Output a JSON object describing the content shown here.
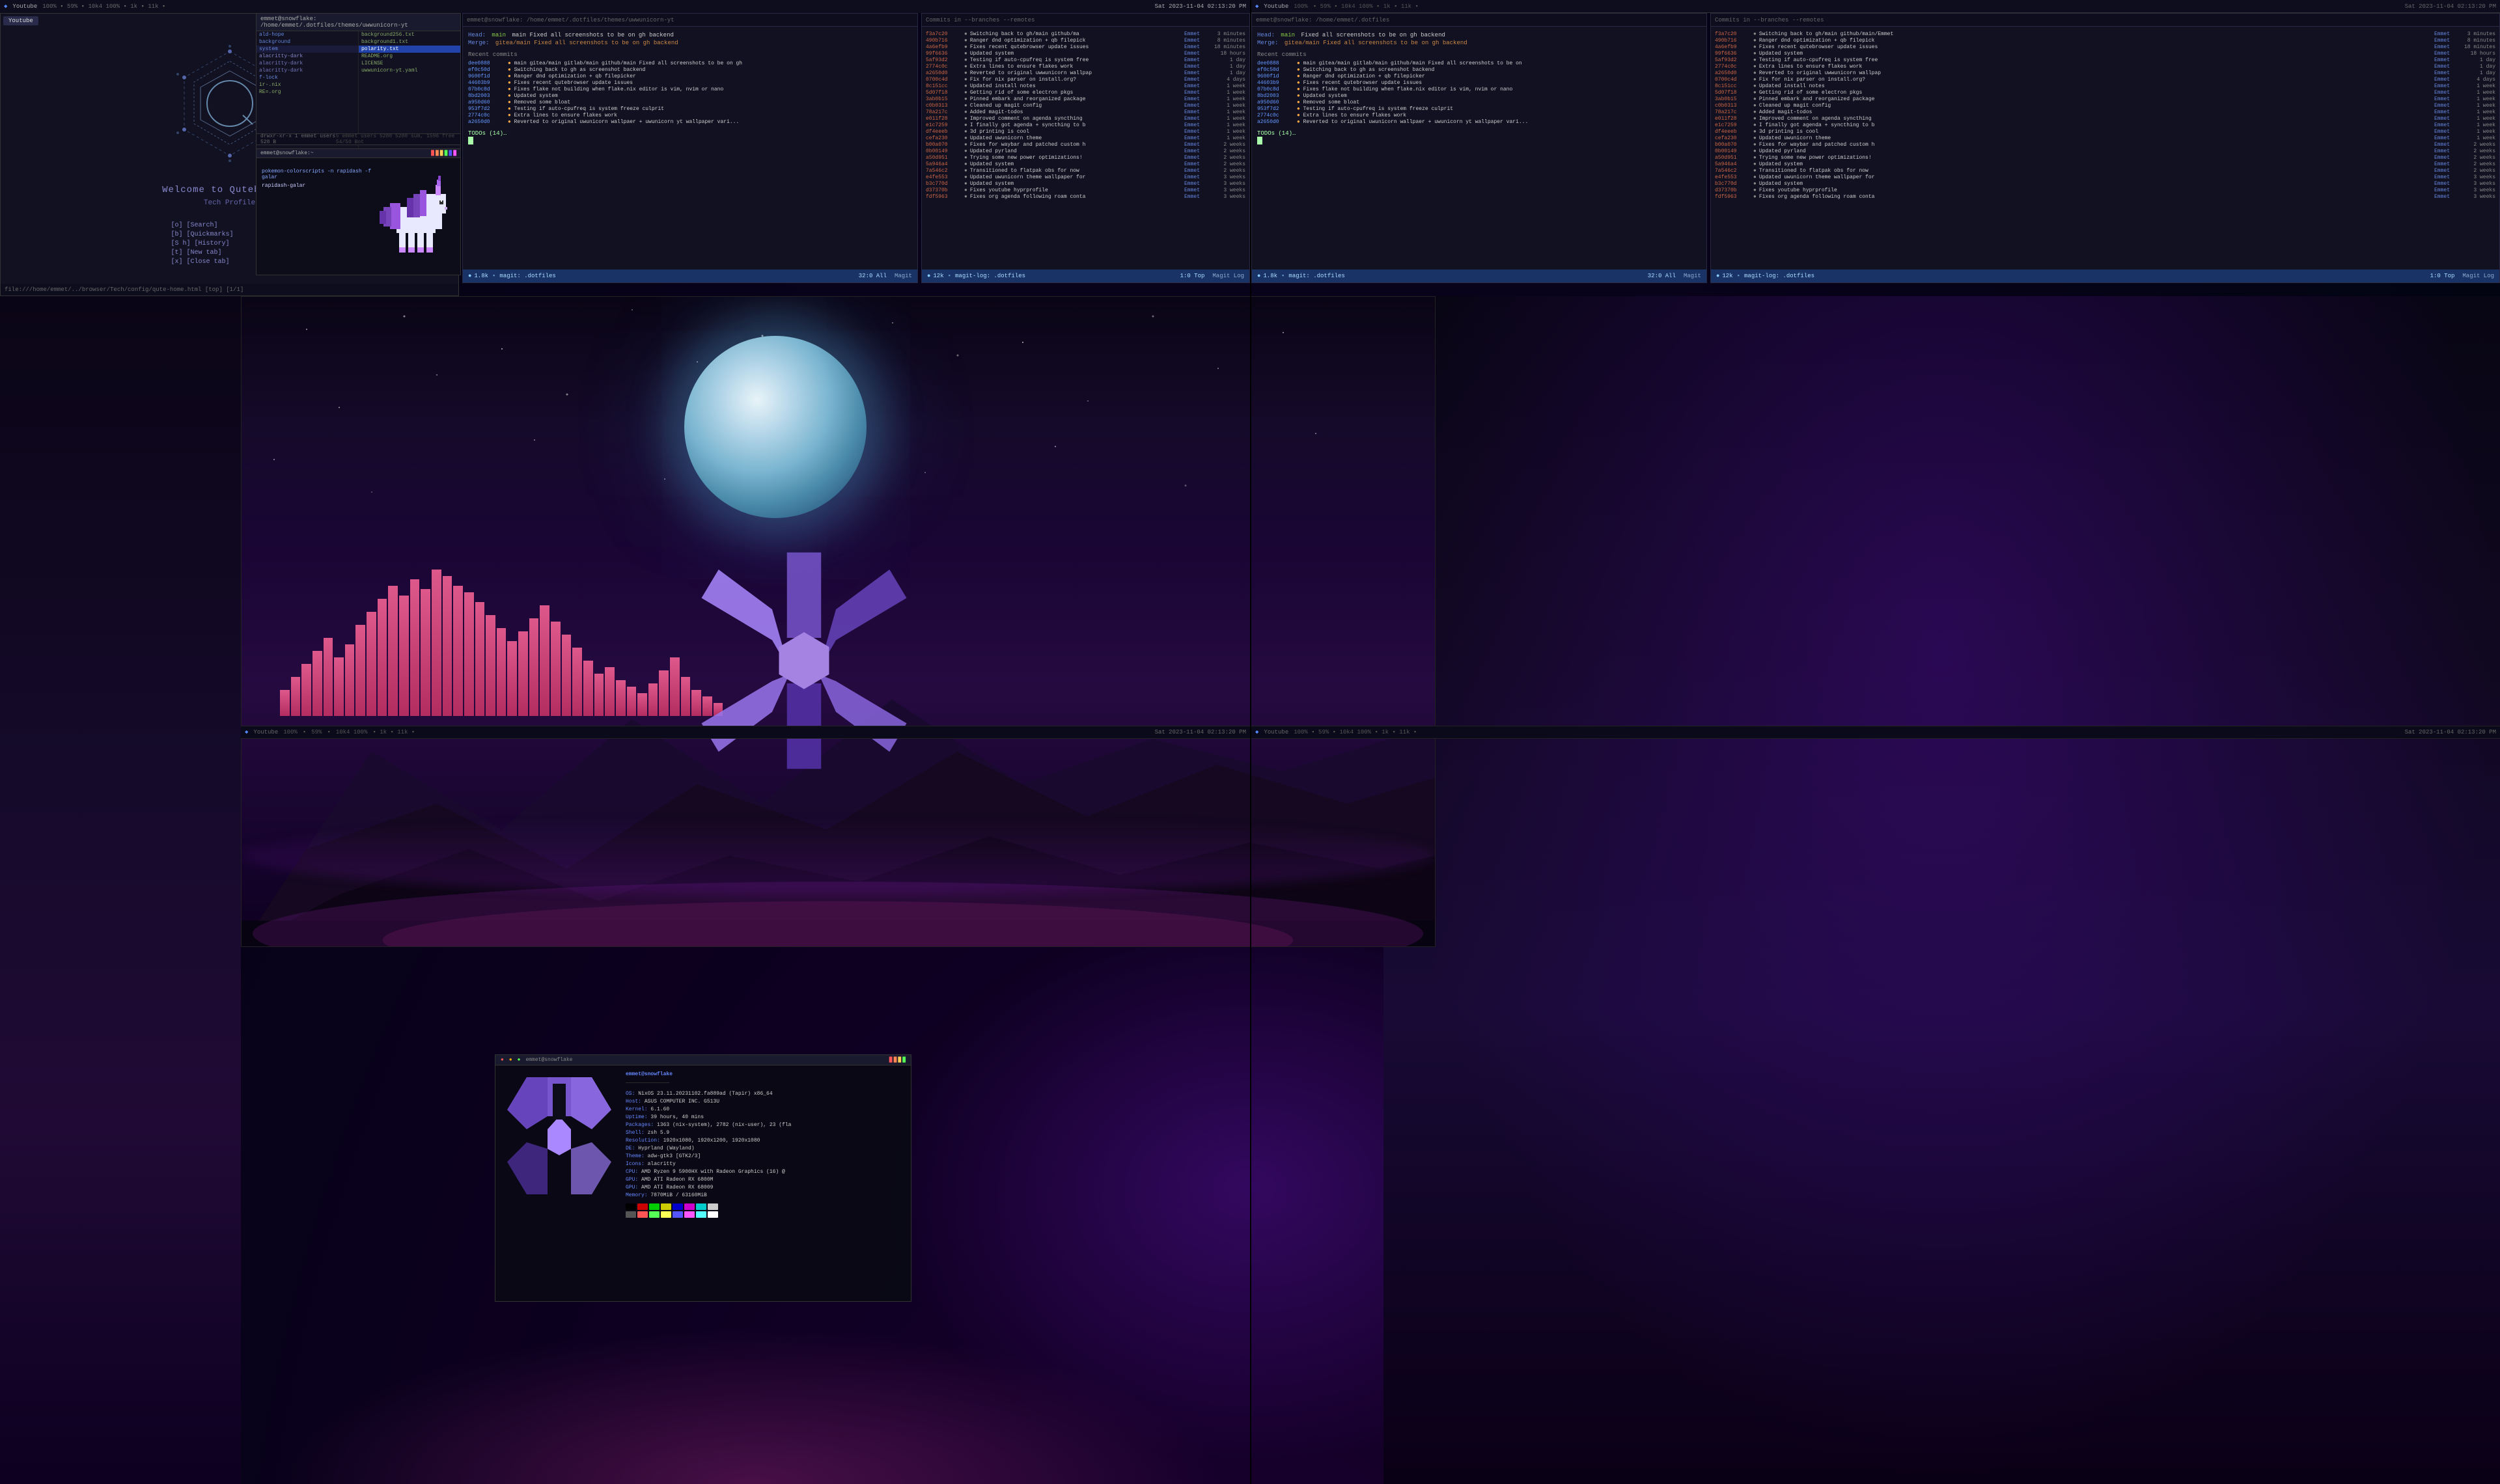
{
  "monitor1": {
    "left_panel": {
      "tab_label": "Youtube",
      "tab_state": "100%",
      "title": "Welcome to Qutebrowser",
      "subtitle": "Tech Profile",
      "menu": [
        "[o] [Search]",
        "[b] [Quickmarks]",
        "[S h] [History]",
        "[t] [New tab]",
        "[x] [Close tab]"
      ],
      "status": "file:///home/emmet/../browser/Tech/config/qute-home.html [top] [1/1]"
    },
    "file_panel": {
      "header": "emmet@snowflake: /home/emmet/.dotfiles/themes/uwwunicorn-yt",
      "col1_files": [
        {
          "name": "ald-hope",
          "type": "dir"
        },
        {
          "name": "background",
          "type": "dir"
        },
        {
          "name": "system",
          "type": "dir"
        },
        {
          "name": "alacritty-dark",
          "type": "dir"
        },
        {
          "name": "alacritty-dark",
          "type": "dir"
        },
        {
          "name": "alacritty-dark",
          "type": "dir"
        },
        {
          "name": "f-lock",
          "type": "dir"
        },
        {
          "name": "ir-.nix",
          "type": "txt"
        },
        {
          "name": "RE=.org",
          "type": "txt"
        }
      ],
      "col2_files": [
        {
          "name": "background256.txt",
          "type": "txt"
        },
        {
          "name": "background1.txt",
          "type": "txt"
        },
        {
          "name": "polarity.txt",
          "type": "txt",
          "selected": true
        },
        {
          "name": "README.org",
          "type": "txt"
        },
        {
          "name": "LICENSE",
          "type": "txt"
        },
        {
          "name": "uwwunicorn-yt.yaml",
          "type": "txt"
        }
      ]
    },
    "pokemon_panel": {
      "header": "emmet@snowflake:~",
      "command": "pokemon-colorscripts -n rapidash -f galar",
      "pokemon_name": "rapidash-galar"
    }
  },
  "git_panel": {
    "header": "emmet@snowflake: /home/emmet/.dotfiles/themes/uwwunicorn-yt",
    "merge_head": "main Fixed all screenshots to be on gh backend",
    "merge_val": "gitea/main Fixed all screenshots to be on gh backend",
    "recent_commits_title": "Recent commits",
    "commits": [
      {
        "hash": "dee0888",
        "msg": "main gitea/main gitlab/main github/main Fixed all screenshots to be on gh backend"
      },
      {
        "hash": "ef0c50d",
        "msg": "Switching back to gh as screenshot backend"
      },
      {
        "hash": "9600f1d",
        "msg": "Ranger dnd optimization + qb filepicker"
      },
      {
        "hash": "44603b9",
        "msg": "Fixes recent qutebrowser update issues"
      },
      {
        "hash": "07b0c8d",
        "msg": "Fixes flake not building when flake.nix editor is vim, nvim or nano"
      },
      {
        "hash": "8bd2003",
        "msg": "Updated system"
      },
      {
        "hash": "a950d60",
        "msg": "Removed some bloat"
      },
      {
        "hash": "953f7d2",
        "msg": "Testing if auto-cpufreq is system freeze culprit"
      },
      {
        "hash": "2774c0c",
        "msg": "Extra lines to ensure flakes work"
      },
      {
        "hash": "a2650d0",
        "msg": "Reverted to original uwunicorn wallpaer + uwunicorn yt wallpaper vari..."
      }
    ],
    "todo": "TODOs (14)…",
    "statusbar_left": "1.8k",
    "statusbar_mode": "magit: .dotfiles",
    "statusbar_right": "32:0 All",
    "statusbar_label": "Magit"
  },
  "git_log_panel": {
    "title": "Commits in --branches --remotes",
    "entries": [
      {
        "hash": "f3a7c20",
        "msg": "Switching back to gh/main github/main/Emmet",
        "time": "3 minutes"
      },
      {
        "hash": "490b716",
        "msg": "Ranger dnd optimization + qb filepick",
        "author": "Emmet",
        "time": "8 minutes"
      },
      {
        "hash": "4a6efb9",
        "msg": "Fixes recent qutebrowser update issues",
        "author": "Emmet",
        "time": "18 minutes"
      },
      {
        "hash": "99f6636",
        "msg": "Updated system",
        "author": "Emmet",
        "time": "18 hours"
      },
      {
        "hash": "5af93d2",
        "msg": "Testing if auto-cpufreq is system free",
        "author": "Emmet",
        "time": "1 day"
      },
      {
        "hash": "2774c0c",
        "msg": "Extra lines to ensure flakes work",
        "author": "Emmet",
        "time": "1 day"
      },
      {
        "hash": "a2650d0",
        "msg": "Reverted to original uwwunicorn wallpap",
        "author": "Emmet",
        "time": "1 day"
      },
      {
        "hash": "0700c4d",
        "msg": "Fix for nix parser on install.org?",
        "author": "Emmet",
        "time": "4 days"
      },
      {
        "hash": "8c151cc",
        "msg": "Updated install notes",
        "author": "Emmet",
        "time": "1 week"
      },
      {
        "hash": "5d07f18",
        "msg": "Getting rid of some electron pkgs",
        "author": "Emmet",
        "time": "1 week"
      },
      {
        "hash": "3ab0b15",
        "msg": "Pinned embark and reorganized package",
        "author": "Emmet",
        "time": "1 week"
      },
      {
        "hash": "c0b0313",
        "msg": "Cleaned up magit config",
        "author": "Emmet",
        "time": "1 week"
      },
      {
        "hash": "78a217c",
        "msg": "Added magit-todos",
        "author": "Emmet",
        "time": "1 week"
      },
      {
        "hash": "e011f28",
        "msg": "Improved comment on agenda syncthing",
        "author": "Emmet",
        "time": "1 week"
      },
      {
        "hash": "e1c7259",
        "msg": "I finally got agenda + syncthing to b",
        "author": "Emmet",
        "time": "1 week"
      },
      {
        "hash": "df4eeeb",
        "msg": "3d printing is cool",
        "author": "Emmet",
        "time": "1 week"
      },
      {
        "hash": "cefa230",
        "msg": "Updated uwunicorn theme",
        "author": "Emmet",
        "time": "1 week"
      },
      {
        "hash": "b00a070",
        "msg": "Fixes for waybar and patched custom h",
        "author": "Emmet",
        "time": "2 weeks"
      },
      {
        "hash": "0b00149",
        "msg": "Updated pyrland",
        "author": "Emmet",
        "time": "2 weeks"
      },
      {
        "hash": "a50d951",
        "msg": "Trying some new power optimizations!",
        "author": "Emmet",
        "time": "2 weeks"
      },
      {
        "hash": "5a946a4",
        "msg": "Updated system",
        "author": "Emmet",
        "time": "2 weeks"
      },
      {
        "hash": "7a546c2",
        "msg": "Transitioned to flatpak obs for now",
        "author": "Emmet",
        "time": "2 weeks"
      },
      {
        "hash": "e4fe553",
        "msg": "Updated uwunicorn theme wallpaper for",
        "author": "Emmet",
        "time": "3 weeks"
      },
      {
        "hash": "b3c770d",
        "msg": "Updated system",
        "author": "Emmet",
        "time": "3 weeks"
      },
      {
        "hash": "d37370b",
        "msg": "Fixes youtube hyprprofile",
        "author": "Emmet",
        "time": "3 weeks"
      },
      {
        "hash": "fdf5963",
        "msg": "Fixes org agenda following roam conta",
        "author": "Emmet",
        "time": "3 weeks"
      }
    ],
    "statusbar_left": "12k",
    "statusbar_mode": "magit-log: .dotfiles",
    "statusbar_right": "1:0 Top",
    "statusbar_label": "Magit Log"
  },
  "taskbar": {
    "left": {
      "icon": "◆",
      "label": "Youtube",
      "stats": "100% ▪ 59% ▪ 10k4 100% ▪ 1k ▪ 11k ▪"
    },
    "right_label": "Sat 2023-11-04 02:13:20 PM"
  },
  "neofetch": {
    "header": "emmet@snowflake",
    "separator": "──────────────",
    "os": "NixOS 23.11.20231102.fa889ad (Tapir) x86_64",
    "host": "ASUS COMPUTER INC. G513U",
    "kernel": "6.1.60",
    "uptime": "39 hours, 40 mins",
    "packages": "1363 (nix-system), 2782 (nix-user), 23 (fla",
    "shell": "zsh 5.9",
    "resolution": "1920x1080, 1920x1200, 1920x1080",
    "de": "Hyprland (Wayland)",
    "wm": "",
    "theme": "adw-gtk3 [GTK2/3]",
    "icons": "alacritty",
    "cpu": "AMD Ryzen 9 5900HX with Radeon Graphics (16) @",
    "gpu1": "AMD ATI Radeon RX 6800M",
    "gpu2": "AMD ATI Radeon RX 68009",
    "memory": "7870MiB / 63160MiB",
    "color_blocks": [
      "#000000",
      "#cc0000",
      "#00cc00",
      "#cccc00",
      "#0000cc",
      "#cc00cc",
      "#00cccc",
      "#cccccc",
      "#555555",
      "#ff5555",
      "#55ff55",
      "#ffff55",
      "#5555ff",
      "#ff55ff",
      "#55ffff",
      "#ffffff"
    ]
  },
  "datetime": "Sat 2023-11-04 02:13:20 PM"
}
